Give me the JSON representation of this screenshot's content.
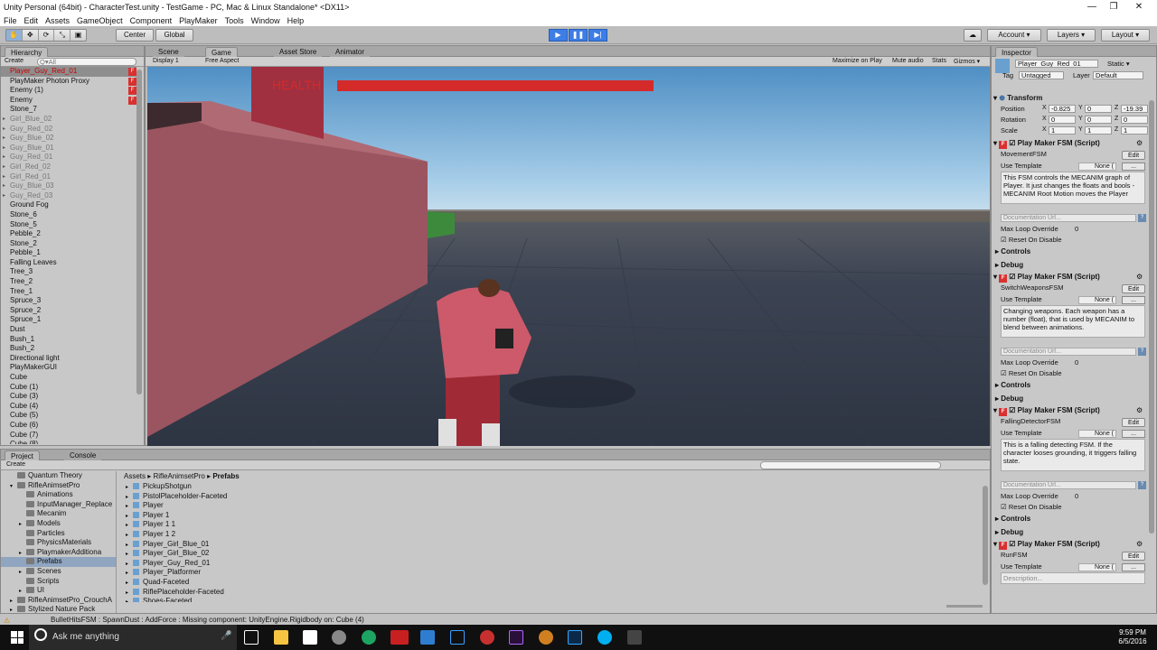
{
  "window": {
    "title": "Unity Personal (64bit) - CharacterTest.unity - TestGame - PC, Mac & Linux Standalone* <DX11>",
    "minimize": "—",
    "maximize": "❐",
    "close": "✕"
  },
  "menu": [
    "File",
    "Edit",
    "Assets",
    "GameObject",
    "Component",
    "PlayMaker",
    "Tools",
    "Window",
    "Help"
  ],
  "toolbar": {
    "center": "Center",
    "global": "Global",
    "account": "Account",
    "layers": "Layers",
    "layout": "Layout"
  },
  "hierarchy": {
    "tab": "Hierarchy",
    "create": "Create",
    "search_placeholder": "Q▾All",
    "items": [
      {
        "label": "Player_Guy_Red_01",
        "sel": true,
        "badge": true
      },
      {
        "label": "PlayMaker Photon Proxy",
        "badge": true
      },
      {
        "label": "Enemy (1)",
        "badge": true
      },
      {
        "label": "Enemy",
        "badge": true
      },
      {
        "label": "Stone_7"
      },
      {
        "label": "Girl_Blue_02",
        "faded": true,
        "arrow": true
      },
      {
        "label": "Guy_Red_02",
        "faded": true,
        "arrow": true
      },
      {
        "label": "Guy_Blue_02",
        "faded": true,
        "arrow": true
      },
      {
        "label": "Guy_Blue_01",
        "faded": true,
        "arrow": true
      },
      {
        "label": "Guy_Red_01",
        "faded": true,
        "arrow": true
      },
      {
        "label": "Girl_Red_02",
        "faded": true,
        "arrow": true
      },
      {
        "label": "Girl_Red_01",
        "faded": true,
        "arrow": true
      },
      {
        "label": "Guy_Blue_03",
        "faded": true,
        "arrow": true
      },
      {
        "label": "Guy_Red_03",
        "faded": true,
        "arrow": true
      },
      {
        "label": "Ground Fog"
      },
      {
        "label": "Stone_6"
      },
      {
        "label": "Stone_5"
      },
      {
        "label": "Pebble_2"
      },
      {
        "label": "Stone_2"
      },
      {
        "label": "Pebble_1"
      },
      {
        "label": "Falling Leaves"
      },
      {
        "label": "Tree_3"
      },
      {
        "label": "Tree_2"
      },
      {
        "label": "Tree_1"
      },
      {
        "label": "Spruce_3"
      },
      {
        "label": "Spruce_2"
      },
      {
        "label": "Spruce_1"
      },
      {
        "label": "Dust"
      },
      {
        "label": "Bush_1"
      },
      {
        "label": "Bush_2"
      },
      {
        "label": "Directional light"
      },
      {
        "label": "PlayMakerGUI"
      },
      {
        "label": "Cube"
      },
      {
        "label": "Cube (1)"
      },
      {
        "label": "Cube (3)"
      },
      {
        "label": "Cube (4)"
      },
      {
        "label": "Cube (5)"
      },
      {
        "label": "Cube (6)"
      },
      {
        "label": "Cube (7)"
      },
      {
        "label": "Cube (8)"
      }
    ]
  },
  "game": {
    "tab_scene": "Scene",
    "tab_game": "Game",
    "tab_store": "Asset Store",
    "tab_animator": "Animator",
    "display": "Display 1",
    "aspect": "Free Aspect",
    "maximize": "Maximize on Play",
    "mute": "Mute audio",
    "stats": "Stats",
    "gizmos": "Gizmos ▾",
    "health_label": "HEALTH",
    "health_value": 1.0
  },
  "project": {
    "tab_project": "Project",
    "tab_console": "Console",
    "create": "Create",
    "tree": [
      {
        "label": "Quantum Theory",
        "indent": 1
      },
      {
        "label": "RifleAnimsetPro",
        "indent": 1,
        "arrow": "▾"
      },
      {
        "label": "Animations",
        "indent": 2
      },
      {
        "label": "InputManager_Replace",
        "indent": 2
      },
      {
        "label": "Mecanim",
        "indent": 2
      },
      {
        "label": "Models",
        "indent": 2,
        "arrow": "▸"
      },
      {
        "label": "Particles",
        "indent": 2
      },
      {
        "label": "PhysicsMaterials",
        "indent": 2
      },
      {
        "label": "PlaymakerAdditiona",
        "indent": 2,
        "arrow": "▸"
      },
      {
        "label": "Prefabs",
        "indent": 2,
        "sel": true
      },
      {
        "label": "Scenes",
        "indent": 2,
        "arrow": "▸"
      },
      {
        "label": "Scripts",
        "indent": 2
      },
      {
        "label": "UI",
        "indent": 2,
        "arrow": "▸"
      },
      {
        "label": "RifleAnimsetPro_CrouchA",
        "indent": 1,
        "arrow": "▸"
      },
      {
        "label": "Stylized Nature Pack",
        "indent": 1,
        "arrow": "▸"
      }
    ],
    "breadcrumb": [
      "Assets",
      "RifleAnimsetPro",
      "Prefabs"
    ],
    "assets": [
      "PickupShotgun",
      "PistolPlaceholder-Faceted",
      "Player",
      "Player 1",
      "Player 1 1",
      "Player 1 2",
      "Player_Girl_Blue_01",
      "Player_Girl_Blue_02",
      "Player_Guy_Red_01",
      "Player_Platformer",
      "Quad-Faceted",
      "RiflePlaceholder-Faceted",
      "Shoes-Faceted"
    ]
  },
  "inspector": {
    "tab": "Inspector",
    "name": "Player_Guy_Red_01",
    "static": "Static ▾",
    "tag_label": "Tag",
    "tag": "Untagged",
    "layer_label": "Layer",
    "layer": "Default",
    "transform": "Transform",
    "pos_label": "Position",
    "pos": [
      "-0.825",
      "0",
      "-19.39"
    ],
    "rot_label": "Rotation",
    "rot": [
      "0",
      "0",
      "0"
    ],
    "scale_label": "Scale",
    "scale": [
      "1",
      "1",
      "1"
    ],
    "fsm_title": "Play Maker FSM (Script)",
    "edit": "Edit",
    "use_template": "Use Template",
    "none": "None (",
    "doc_url": "Documentation Url...",
    "max_loop": "Max Loop Override",
    "max_loop_value": "0",
    "reset": "Reset On Disable",
    "controls": "Controls",
    "debug": "Debug",
    "desc_placeholder": "Description...",
    "fsms": [
      {
        "name": "MovementFSM",
        "desc": "This FSM controls the MECANIM graph of Player. It just changes the floats and bools - MECANIM Root Motion moves the Player"
      },
      {
        "name": "SwitchWeaponsFSM",
        "desc": "Changing weapons. Each weapon has a number (float), that is used by MECANIM to blend between animations."
      },
      {
        "name": "FallingDetectorFSM",
        "desc": "This is a falling detecting FSM. If the character looses grounding, it triggers falling state."
      },
      {
        "name": "RunFSM",
        "desc": ""
      }
    ]
  },
  "status": "BulletHitsFSM : SpawnDust : AddForce : Missing component: UnityEngine.Rigidbody on: Cube (4)",
  "taskbar": {
    "search": "Ask me anything",
    "time": "9:59 PM",
    "date": "6/5/2016"
  },
  "colors": {
    "accent": "#3d7de6",
    "health": "#d42a2a",
    "sky": "#9ec9e8",
    "floor": "#3a4253",
    "wall": "#9a5560"
  }
}
